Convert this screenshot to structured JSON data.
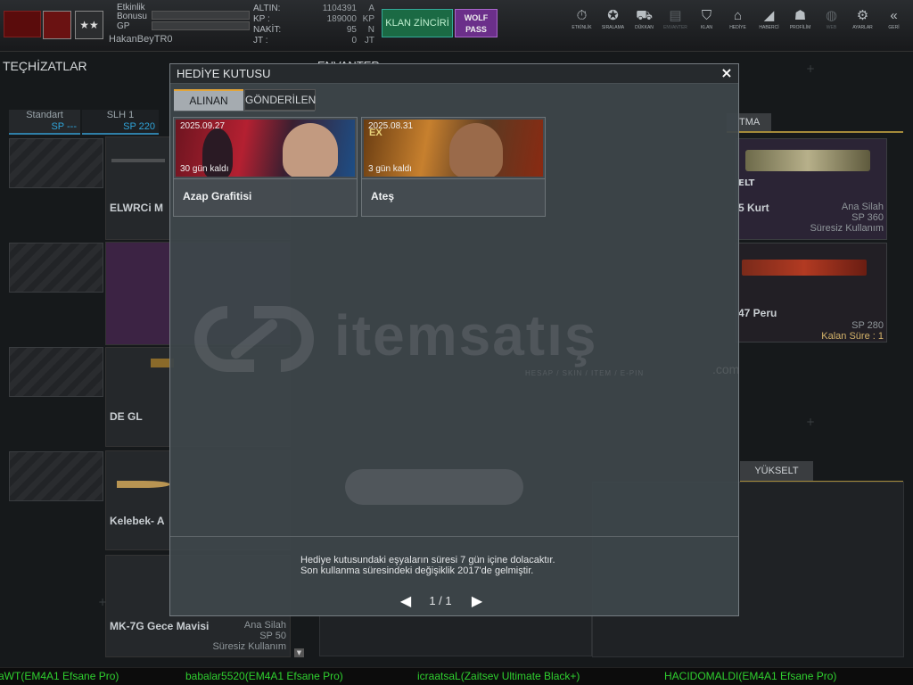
{
  "header": {
    "username": "HakanBeyTR0",
    "labels": {
      "etkinlik": "Etkinlik",
      "bonusu": "Bonusu",
      "gp": "GP"
    },
    "currencies": [
      {
        "key": "ALTIN:",
        "value": "1104391",
        "unit": "A"
      },
      {
        "key": "KP :",
        "value": "189000",
        "unit": "KP"
      },
      {
        "key": "NAKİT:",
        "value": "95",
        "unit": "N"
      },
      {
        "key": "JT :",
        "value": "0",
        "unit": "JT"
      }
    ],
    "klan_label": "KLAN ZİNCİRİ",
    "wolf_label_1": "WOLF",
    "wolf_label_2": "PASS",
    "nav": [
      {
        "label": "ETKİNLİK",
        "icon": "stopwatch-icon",
        "glyph": "⏱"
      },
      {
        "label": "SIRALAMA",
        "icon": "medal-icon",
        "glyph": "✪"
      },
      {
        "label": "DÜKKAN",
        "icon": "cart-icon",
        "glyph": "⛟"
      },
      {
        "label": "ENVANTER",
        "icon": "inventory-icon",
        "glyph": "▤",
        "dim": true
      },
      {
        "label": "KLAN",
        "icon": "shield-icon",
        "glyph": "⛉"
      },
      {
        "label": "HEDİYE",
        "icon": "gift-icon",
        "glyph": "⌂"
      },
      {
        "label": "HABERCİ",
        "icon": "megaphone-icon",
        "glyph": "◢"
      },
      {
        "label": "PROFİLİM",
        "icon": "profile-icon",
        "glyph": "☗"
      },
      {
        "label": "WEB",
        "icon": "globe-icon",
        "glyph": "◍",
        "dim": true
      },
      {
        "label": "AYARLAR",
        "icon": "gear-icon",
        "glyph": "⚙"
      },
      {
        "label": "GERİ",
        "icon": "back-icon",
        "glyph": "«"
      }
    ]
  },
  "left": {
    "title": "TEÇHİZATLAR",
    "tabs": [
      {
        "name": "Standart",
        "sp": "SP ---"
      },
      {
        "name": "SLH 1",
        "sp": "SP 220"
      }
    ],
    "cards": [
      {
        "name": "ELWRCi M",
        "meta1": "",
        "meta2": "",
        "meta3": ""
      },
      {
        "name": "",
        "meta1": "",
        "meta2": "",
        "meta3": ""
      },
      {
        "name": "DE GL",
        "meta1": "",
        "meta2": "",
        "meta3": ""
      },
      {
        "name": "Kelebek- A",
        "meta1": "",
        "meta2": "",
        "meta3": ""
      },
      {
        "name": "MK-7G Gece Mavisi",
        "meta1": "Ana Silah",
        "meta2": "SP 50",
        "meta3": "Süresiz Kullanım"
      }
    ]
  },
  "envanter_title": "ENVANTER",
  "right": {
    "tab_top": "TMA",
    "tab_bottom": "YÜKSELT",
    "cards": [
      {
        "name": "5 Kurt",
        "meta1": "Ana Silah",
        "meta2": "SP 360",
        "meta3": "Süresiz Kullanım",
        "badge": "ELT"
      },
      {
        "name": "47 Peru",
        "meta1": "",
        "meta2": "SP 280",
        "meta3": "Kalan Süre : 1"
      }
    ]
  },
  "modal": {
    "title": "HEDİYE KUTUSU",
    "close_label": "×",
    "tabs": {
      "received": "ALINAN",
      "sent": "GÖNDERİLEN"
    },
    "gifts": [
      {
        "date": "2025.09.27",
        "days_left": "30 gün kaldı",
        "name": "Azap Grafitisi"
      },
      {
        "date": "2025.08.31",
        "days_left": "3 gün kaldı",
        "name": "Ateş",
        "badge": "EX"
      }
    ],
    "note_line1": "Hediye kutusundaki eşyaların süresi 7 gün içine dolacaktır.",
    "note_line2": "Son kullanma süresindeki değişiklik 2017'de gelmiştir.",
    "pagination": {
      "current": "1",
      "total": "1",
      "display": "1 / 1",
      "prev": "◀",
      "next": "▶"
    }
  },
  "watermark": {
    "text": "itemsatış",
    "subtext": "HESAP / SKIN / ITEM / E-PIN",
    "domain": ".com"
  },
  "ticker": [
    "aWT(EM4A1 Efsane Pro)",
    "babalar5520(EM4A1 Efsane Pro)",
    "icraatsaL(Zaitsev Ultimate Black+)",
    "HACIDOMALDI(EM4A1 Efsane Pro)"
  ],
  "colors": {
    "accent_gold": "#e1a43a",
    "ticker_green": "#2fd02f",
    "klan_green": "#1b6a44",
    "wolf_purple": "#6b2f8a"
  }
}
